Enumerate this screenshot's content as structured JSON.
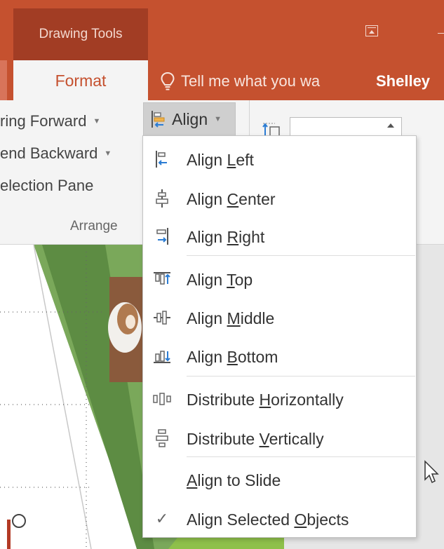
{
  "titlebar": {
    "context_tab": "Drawing Tools"
  },
  "tabs": {
    "format": "Format"
  },
  "tell_me": {
    "text": "Tell me what you wa"
  },
  "user": {
    "name": "Shelley"
  },
  "ribbon": {
    "items": [
      "ring Forward",
      "end Backward",
      "election Pane"
    ],
    "group_label": "Arrange",
    "align_button": "Align",
    "size_value": ""
  },
  "menu": {
    "items": [
      {
        "pre": "Align ",
        "key": "L",
        "post": "eft",
        "icon": "align-left-icon"
      },
      {
        "pre": "Align ",
        "key": "C",
        "post": "enter",
        "icon": "align-center-icon"
      },
      {
        "pre": "Align ",
        "key": "R",
        "post": "ight",
        "icon": "align-right-icon"
      },
      {
        "pre": "Align ",
        "key": "T",
        "post": "op",
        "icon": "align-top-icon"
      },
      {
        "pre": "Align ",
        "key": "M",
        "post": "iddle",
        "icon": "align-middle-icon"
      },
      {
        "pre": "Align ",
        "key": "B",
        "post": "ottom",
        "icon": "align-bottom-icon"
      },
      {
        "pre": "Distribute ",
        "key": "H",
        "post": "orizontally",
        "icon": "distribute-horizontally-icon"
      },
      {
        "pre": "Distribute ",
        "key": "V",
        "post": "ertically",
        "icon": "distribute-vertically-icon"
      },
      {
        "pre": "",
        "key": "A",
        "post": "lign to Slide",
        "icon": ""
      },
      {
        "pre": "Align Selected ",
        "key": "O",
        "post": "bjects",
        "icon": "checkmark-icon",
        "checked": true
      }
    ]
  },
  "colors": {
    "accent": "#c5512f",
    "accent_dark": "#a23d24",
    "icon_blue": "#2b7cd3",
    "slide_green": "#6a9a4e"
  }
}
